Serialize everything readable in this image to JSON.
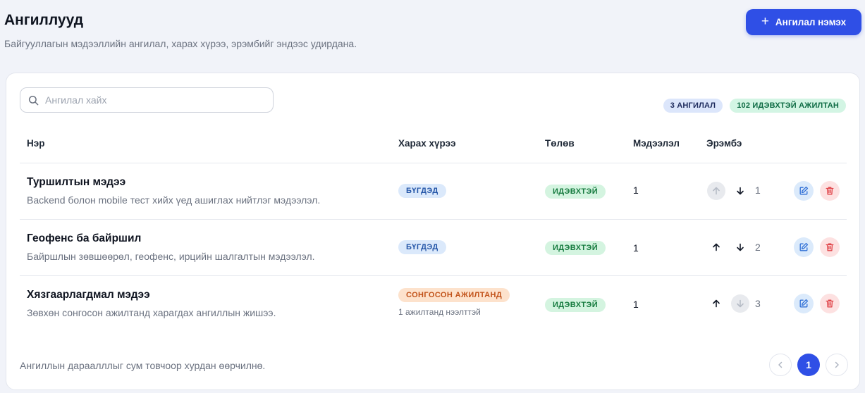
{
  "header": {
    "title": "Ангиллууд",
    "subtitle": "Байгууллагын мэдээллийн ангилал, харах хүрээ, эрэмбийг эндээс удирдана.",
    "add_button_label": "Ангилал нэмэх"
  },
  "toolbar": {
    "search_placeholder": "Ангилал хайх",
    "category_count": "3 АНГИЛАЛ",
    "active_employees": "102 ИДЭВХТЭЙ АЖИЛТАН"
  },
  "table": {
    "columns": {
      "name": "Нэр",
      "scope": "Харах хүрээ",
      "status": "Төлөв",
      "count": "Мэдээлэл",
      "order": "Эрэмбэ"
    },
    "rows": [
      {
        "name": "Туршилтын мэдээ",
        "description": "Backend болон mobile тест хийх үед ашиглах нийтлэг мэдээлэл.",
        "scope": "БҮГДЭД",
        "scope_note": "",
        "status": "ИДЭВХТЭЙ",
        "count": "1",
        "order": "1"
      },
      {
        "name": "Геофенс ба байршил",
        "description": "Байршлын зөвшөөрөл, геофенс, ирцийн шалгалтын мэдээлэл.",
        "scope": "БҮГДЭД",
        "scope_note": "",
        "status": "ИДЭВХТЭЙ",
        "count": "1",
        "order": "2"
      },
      {
        "name": "Хязгаарлагдмал мэдээ",
        "description": "Зөвхөн сонгосон ажилтанд харагдах ангиллын жишээ.",
        "scope": "СОНГОСОН АЖИЛТАНД",
        "scope_note": "1 ажилтанд нээлттэй",
        "status": "ИДЭВХТЭЙ",
        "count": "1",
        "order": "3"
      }
    ]
  },
  "footer": {
    "note": "Ангиллын дараалллыг сум товчоор хурдан өөрчилнө.",
    "current_page": "1"
  },
  "colors": {
    "primary": "#2f4fe6",
    "edit_bg": "#dbeafb",
    "delete_bg": "#fde1e1",
    "delete_icon": "#e0454a",
    "edit_icon": "#2f6fd6"
  }
}
